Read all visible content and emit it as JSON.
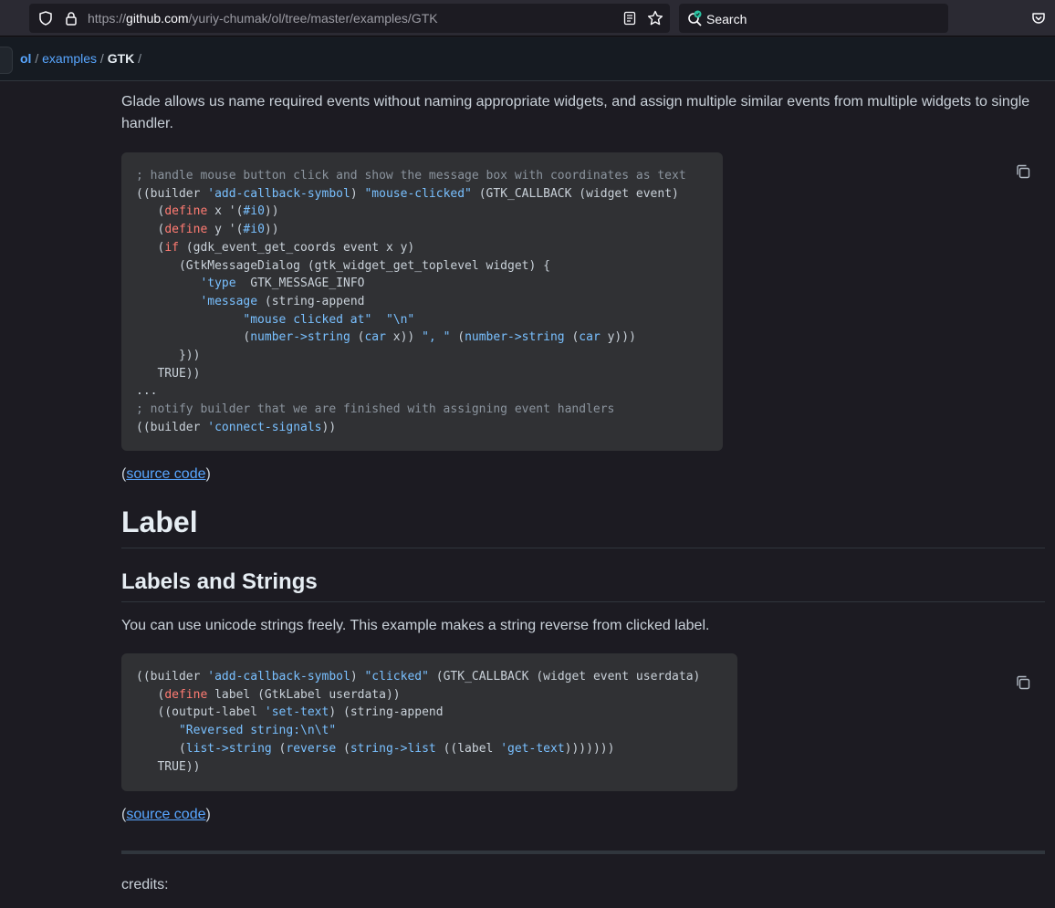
{
  "browser": {
    "url_prefix": "https://",
    "url_host": "github.com",
    "url_path": "/yuriy-chumak/ol/tree/master/examples/GTK",
    "search_placeholder": "Search"
  },
  "breadcrumb": {
    "repo": "ol",
    "sep1": " / ",
    "folder": "examples",
    "sep2": " / ",
    "current": "GTK",
    "sep3": " /"
  },
  "intro_text": "Glade allows us name required events without naming appropriate widgets, and assign multiple similar events from multiple widgets to single handler.",
  "code1": {
    "c1": "; handle mouse button click and show the message box with coordinates as text",
    "l2a": "((builder ",
    "l2b": "'add-callback-symbol",
    "l2c": ") ",
    "l2d": "\"mouse-clicked\"",
    "l2e": " (GTK_CALLBACK (widget event)",
    "l3a": "   (",
    "l3b": "define",
    "l3c": " x '(",
    "l3d": "#i0",
    "l3e": "))",
    "l4a": "   (",
    "l4b": "define",
    "l4c": " y '(",
    "l4d": "#i0",
    "l4e": "))",
    "l5a": "   (",
    "l5b": "if",
    "l5c": " (gdk_event_get_coords event x y)",
    "l6": "      (GtkMessageDialog (gtk_widget_get_toplevel widget) {",
    "l7a": "         ",
    "l7b": "'type",
    "l7c": "  GTK_MESSAGE_INFO",
    "l8a": "         ",
    "l8b": "'message",
    "l8c": " (string-append",
    "l9a": "               ",
    "l9b": "\"mouse clicked at\"",
    "l9c": "  ",
    "l9d": "\"\\n\"",
    "l10a": "               (",
    "l10b": "number->string",
    "l10c": " (",
    "l10d": "car",
    "l10e": " x)) ",
    "l10f": "\", \"",
    "l10g": " (",
    "l10h": "number->string",
    "l10i": " (",
    "l10j": "car",
    "l10k": " y)))",
    "l11": "      }))",
    "l12": "   TRUE))",
    "l13": "...",
    "c2": "; notify builder that we are finished with assigning event handlers",
    "l15a": "((builder ",
    "l15b": "'connect-signals",
    "l15c": "))"
  },
  "source1": {
    "open": "(",
    "link": "source code",
    "close": ")"
  },
  "h_label": "Label",
  "h_labels_strings": "Labels and Strings",
  "labels_text": "You can use unicode strings freely. This example makes a string reverse from clicked label.",
  "code2": {
    "l1a": "((builder ",
    "l1b": "'add-callback-symbol",
    "l1c": ") ",
    "l1d": "\"clicked\"",
    "l1e": " (GTK_CALLBACK (widget event userdata)",
    "l2a": "   (",
    "l2b": "define",
    "l2c": " label (GtkLabel userdata))",
    "l3a": "   ((output-label ",
    "l3b": "'set-text",
    "l3c": ") (string-append",
    "l4a": "      ",
    "l4b": "\"Reversed string:\\n\\t\"",
    "l5a": "      (",
    "l5b": "list->string",
    "l5c": " (",
    "l5d": "reverse",
    "l5e": " (",
    "l5f": "string->list",
    "l5g": " ((label ",
    "l5h": "'get-text",
    "l5i": ")))))))",
    "l6": "   TRUE))"
  },
  "source2": {
    "open": "(",
    "link": "source code",
    "close": ")"
  },
  "credits": "credits:",
  "icons": {
    "shield": "shield-icon",
    "lock": "lock-icon",
    "reader": "reader-view-icon",
    "star": "bookmark-star-icon",
    "search": "search-icon",
    "pocket": "pocket-icon",
    "copy": "copy-icon"
  }
}
